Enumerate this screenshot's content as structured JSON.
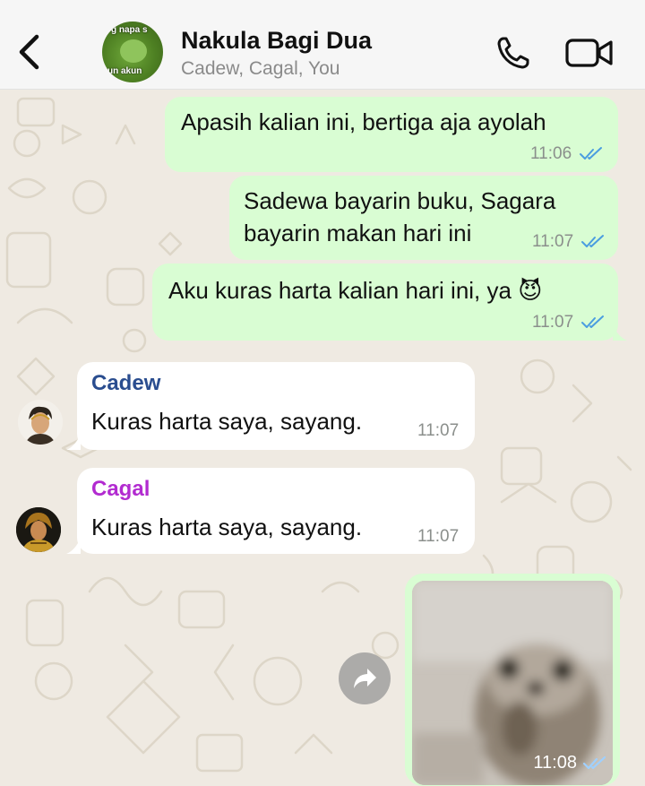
{
  "header": {
    "title": "Nakula Bagi Dua",
    "subtitle": "Cadew, Cagal, You",
    "avatar_caption_top": "g napa s",
    "avatar_caption_bottom": "un akun"
  },
  "messages": [
    {
      "direction": "out",
      "text": "Apasih kalian ini, bertiga aja ayolah",
      "time": "11:06",
      "status": "read"
    },
    {
      "direction": "out",
      "lines": [
        "Sadewa bayarin buku, Sagara",
        "bayarin makan hari ini"
      ],
      "time": "11:07",
      "status": "read"
    },
    {
      "direction": "out",
      "text": "Aku kuras harta kalian hari ini, ya 😈",
      "time": "11:07",
      "status": "read"
    },
    {
      "direction": "in",
      "sender": "Cadew",
      "sender_color": "#2a4d8f",
      "text": "Kuras harta saya, sayang.",
      "time": "11:07"
    },
    {
      "direction": "in",
      "sender": "Cagal",
      "sender_color": "#b22bd0",
      "text": "Kuras harta saya, sayang.",
      "time": "11:07"
    },
    {
      "direction": "out",
      "type": "media",
      "time": "11:08",
      "status": "read"
    }
  ],
  "colors": {
    "outgoing_bubble": "#d9fdd3",
    "incoming_bubble": "#ffffff",
    "chat_background": "#efeae2",
    "read_ticks": "#4a9de0"
  },
  "icons": {
    "back": "chevron-left-icon",
    "call": "phone-icon",
    "video": "video-camera-icon",
    "forward": "forward-arrow-icon",
    "status": "double-check-icon"
  }
}
